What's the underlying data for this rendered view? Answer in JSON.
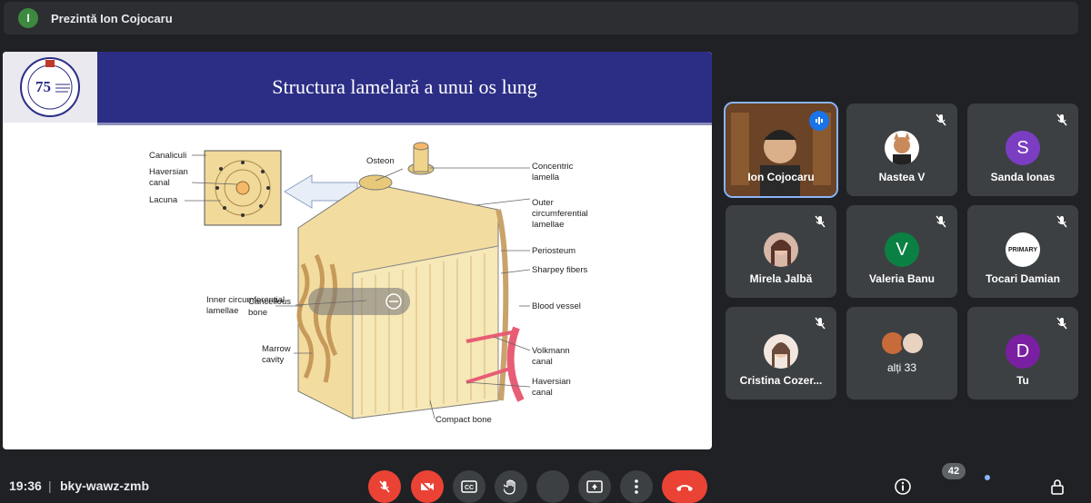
{
  "presentation_bar": {
    "avatar_letter": "I",
    "text": "Prezintă Ion Cojocaru"
  },
  "slide": {
    "title": "Structura lamelară a unui os lung",
    "logo_text": "75",
    "diagram_labels": {
      "canaliculi": "Canaliculi",
      "haversian_canal_1": "Haversian",
      "haversian_canal_2": "canal",
      "lacuna": "Lacuna",
      "osteon": "Osteon",
      "concentric_1": "Concentric",
      "concentric_2": "lamella",
      "outer_1": "Outer",
      "outer_2": "circumferential",
      "outer_3": "lamellae",
      "inner_1": "Inner circumferential",
      "inner_2": "lamellae",
      "periosteum": "Periosteum",
      "sharpey": "Sharpey fibers",
      "cancellous_1": "Cancellous",
      "cancellous_2": "bone",
      "blood_vessel": "Blood vessel",
      "marrow_1": "Marrow",
      "marrow_2": "cavity",
      "volkmann_1": "Volkmann",
      "volkmann_2": "canal",
      "haversian_b_1": "Haversian",
      "haversian_b_2": "canal",
      "compact_bone": "Compact bone"
    }
  },
  "participants": [
    {
      "name": "Ion Cojocaru",
      "type": "video",
      "speaking": true
    },
    {
      "name": "Nastea V",
      "type": "photo",
      "muted": true
    },
    {
      "name": "Sanda Ionas",
      "type": "letter",
      "letter": "S",
      "color": "#7b3ec3",
      "muted": true
    },
    {
      "name": "Mirela Jalbă",
      "type": "photo",
      "muted": true
    },
    {
      "name": "Valeria Banu",
      "type": "letter",
      "letter": "V",
      "color": "#0b8043",
      "muted": true
    },
    {
      "name": "Tocari Damian",
      "type": "logo",
      "logo_text": "PRIMARY",
      "muted": true
    },
    {
      "name": "Cristina Cozer...",
      "type": "photo",
      "muted": true
    },
    {
      "name": "alți 33",
      "type": "group"
    },
    {
      "name": "Tu",
      "type": "letter",
      "letter": "D",
      "color": "#7b1fa2",
      "muted": true
    }
  ],
  "bottom_bar": {
    "time": "19:36",
    "separator": "|",
    "meeting_code": "bky-wawz-zmb",
    "people_count": "42"
  },
  "colors": {
    "background": "#202124",
    "tile": "#3c4043",
    "red": "#ea4335",
    "slide_band": "#2c2e86",
    "accent_blue": "#8ab4f8"
  }
}
